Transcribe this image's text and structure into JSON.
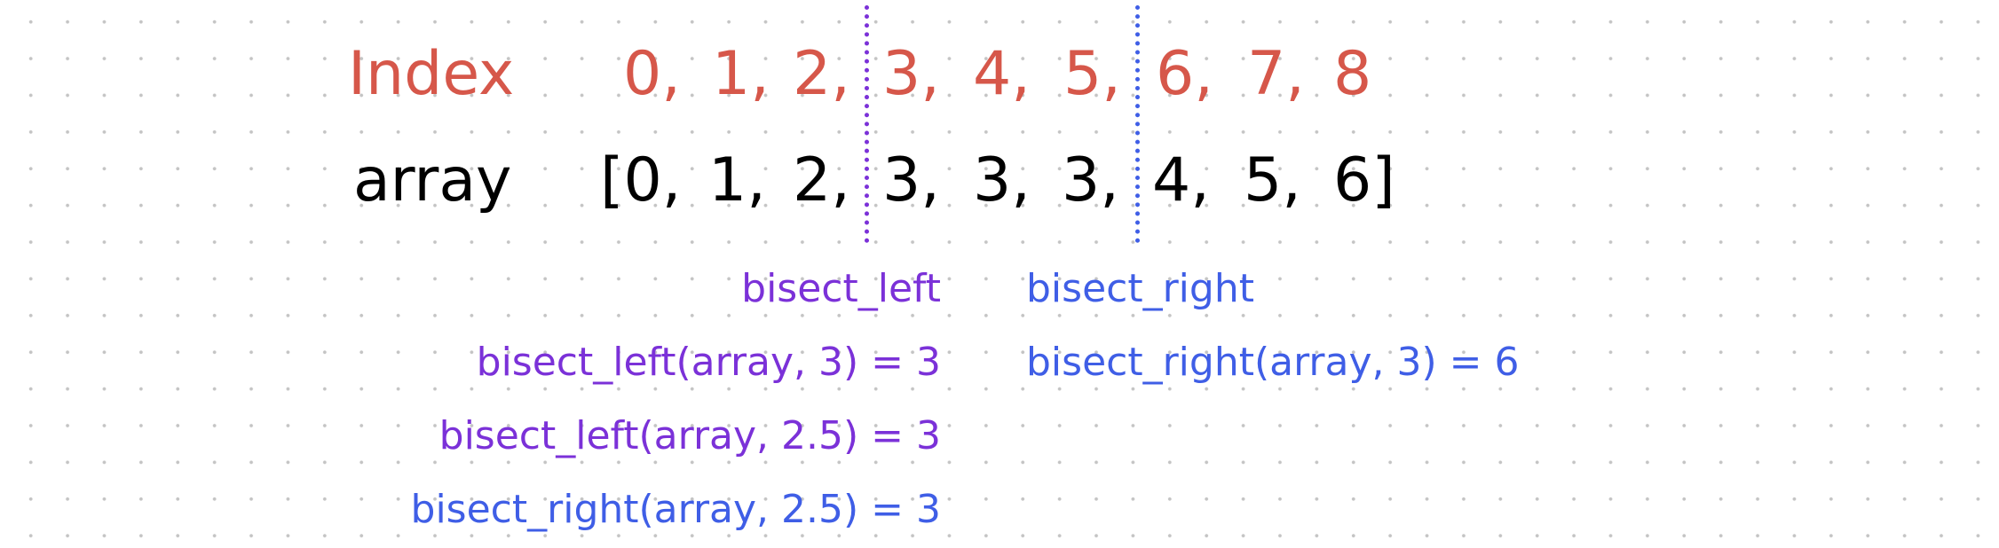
{
  "index_row": {
    "label": "Index",
    "cells": [
      "0,",
      "1,",
      "2,",
      "3,",
      "4,",
      "5,",
      "6,",
      "7,",
      "8"
    ]
  },
  "array_row": {
    "label": "array",
    "cells": [
      "[0,",
      "1,",
      "2,",
      "3,",
      "3,",
      "3,",
      "4,",
      "5,",
      "6]"
    ]
  },
  "dividers": {
    "left_name": "bisect_left",
    "right_name": "bisect_right"
  },
  "annotations": {
    "left_col": [
      "bisect_left(array, 3) = 3",
      "bisect_left(array, 2.5) = 3",
      "bisect_right(array, 2.5) = 3"
    ],
    "right_col": [
      "bisect_right(array, 3) = 6"
    ]
  },
  "colors": {
    "index": "#d6574a",
    "array": "#000000",
    "bisect_left": "#7b31d8",
    "bisect_right": "#3f5ee6"
  }
}
